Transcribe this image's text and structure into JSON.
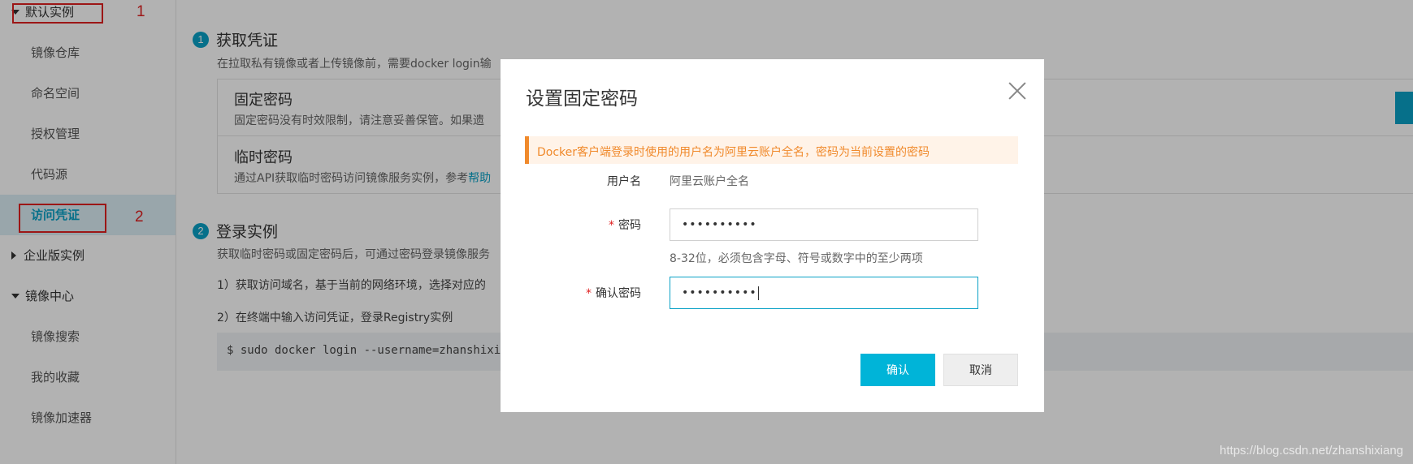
{
  "sidebar": {
    "group_default": "默认实例",
    "items_default": [
      "镜像仓库",
      "命名空间",
      "授权管理",
      "代码源",
      "访问凭证"
    ],
    "group_enterprise": "企业版实例",
    "group_mirror_center": "镜像中心",
    "items_mirror_center": [
      "镜像搜索",
      "我的收藏",
      "镜像加速器"
    ]
  },
  "annotations": {
    "mark1": "1",
    "mark2": "2"
  },
  "main": {
    "step1": {
      "num": "1",
      "title": "获取凭证",
      "desc": "在拉取私有镜像或者上传镜像前，需要docker login输"
    },
    "fixed_password": {
      "title": "固定密码",
      "desc": "固定密码没有时效限制，请注意妥善保管。如果遗"
    },
    "temp_password": {
      "title": "临时密码",
      "desc": "通过API获取临时密码访问镜像服务实例，参考",
      "link": "帮助"
    },
    "step2": {
      "num": "2",
      "title": "登录实例",
      "desc": "获取临时密码或固定密码后，可通过密码登录镜像服务",
      "line1": "1）获取访问域名，基于当前的网络环境，选择对应的",
      "line2": "2）在终端中输入访问凭证，登录Registry实例"
    },
    "code": "$ sudo docker login --username=zhanshixian"
  },
  "modal": {
    "title": "设置固定密码",
    "alert": "Docker客户端登录时使用的用户名为阿里云账户全名，密码为当前设置的密码",
    "username_label": "用户名",
    "username_value": "阿里云账户全名",
    "password_label": "密码",
    "password_value": "••••••••••",
    "password_hint": "8-32位，必须包含字母、符号或数字中的至少两项",
    "confirm_label": "确认密码",
    "confirm_value": "••••••••••",
    "required_mark": "*",
    "confirm_button": "确认",
    "cancel_button": "取消"
  },
  "watermark": "https://blog.csdn.net/zhanshixiang",
  "colors": {
    "accent": "#0aa1c6",
    "alert": "#f08a2c",
    "annotation": "#e02020"
  }
}
